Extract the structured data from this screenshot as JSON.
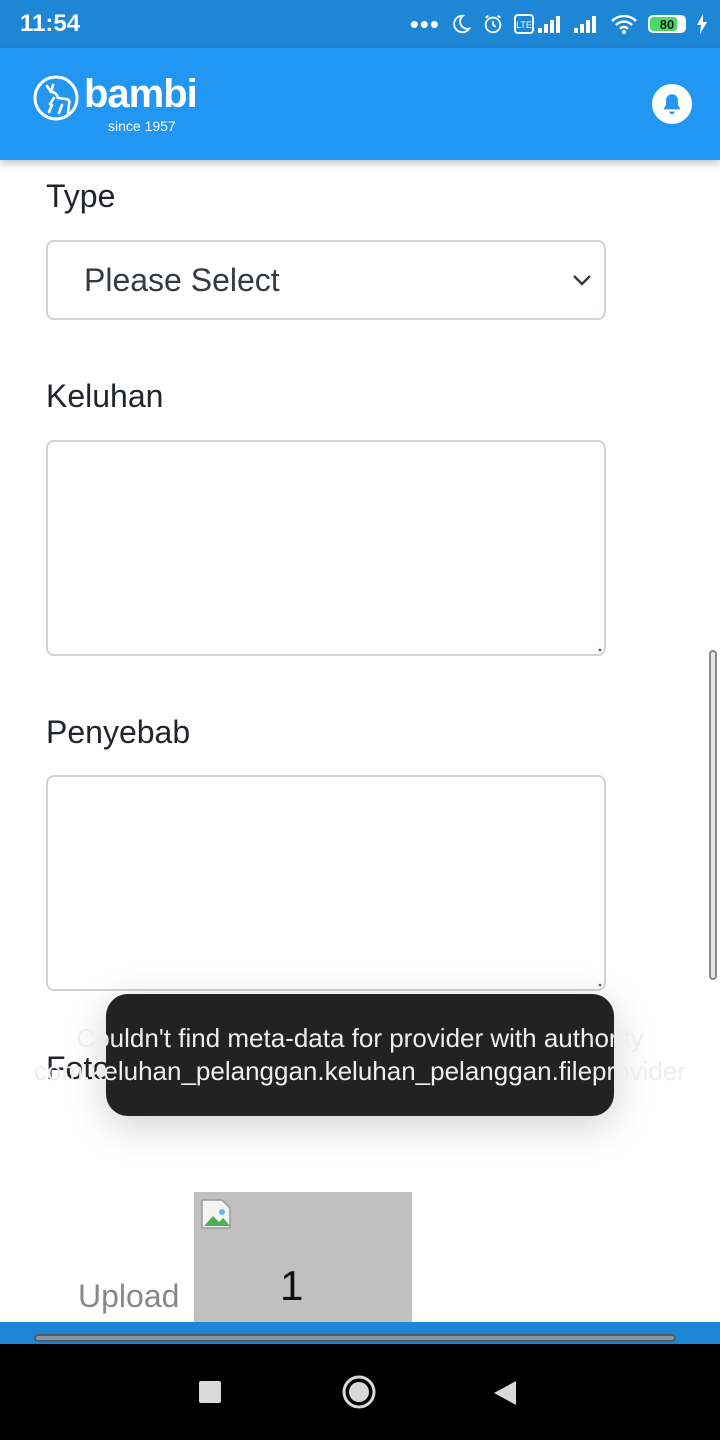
{
  "status_bar": {
    "time": "11:54",
    "battery": "80",
    "network_badge": "Vo LTE"
  },
  "header": {
    "brand_name": "bambi",
    "brand_tagline": "since 1957"
  },
  "form": {
    "type_label": "Type",
    "type_value": "Please Select",
    "keluhan_label": "Keluhan",
    "keluhan_value": "",
    "penyebab_label": "Penyebab",
    "penyebab_value": "",
    "foto_label": "Foto"
  },
  "upload": {
    "label": "Upload",
    "photo_index": "1"
  },
  "toast": {
    "message": "Couldn't find meta-data for provider with authority com.keluhan_pelanggan.keluhan_pelanggan.fileprovider"
  },
  "colors": {
    "header": "#2196f3",
    "status_bar": "#1d87d6",
    "toast_bg": "#222222"
  }
}
